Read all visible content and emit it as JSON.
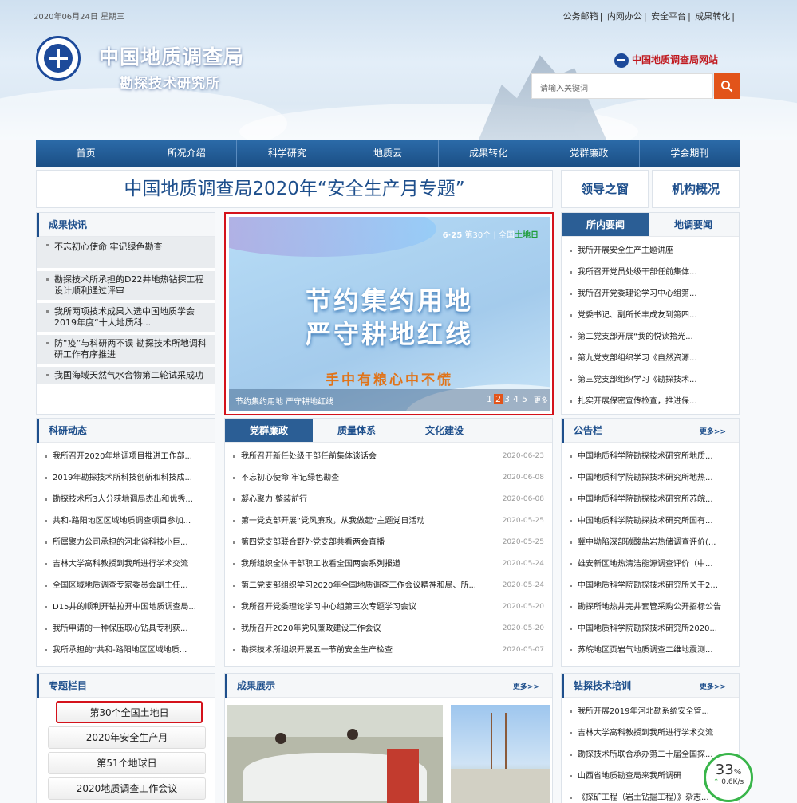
{
  "header": {
    "date": "2020年06月24日 星期三",
    "top_links": [
      "公务邮箱",
      "内网办公",
      "安全平台",
      "成果转化"
    ],
    "org_name": "中国地质调查局",
    "inst_name": "勘探技术研究所",
    "site_link": "中国地质调查局网站",
    "search_placeholder": "请输入关键词"
  },
  "nav": [
    "首页",
    "所况介绍",
    "科学研究",
    "地质云",
    "成果转化",
    "党群廉政",
    "学会期刊"
  ],
  "banner": {
    "title": "中国地质调查局2020年“安全生产月专题”",
    "btn1": "领导之窗",
    "btn2": "机构概况"
  },
  "kuaixun": {
    "title": "成果快讯",
    "items": [
      "不忘初心使命 牢记绿色勘查",
      "勘探技术所承担的D22井地热钻探工程设计顺利通过评审",
      "我所两项技术成果入选中国地质学会2019年度“十大地质科...",
      "防“疫”与科研两不误 勘探技术所地调科研工作有序推进",
      "我国海域天然气水合物第二轮试采成功"
    ]
  },
  "slider": {
    "tag_date": "6·25",
    "tag_rest": "第30个 | 全国",
    "tag_green": "土地日",
    "line1": "节约集约用地",
    "line2": "严守耕地红线",
    "line3": "手中有粮心中不慌",
    "caption": "节约集约用地 严守耕地红线",
    "pages": [
      "1",
      "2",
      "3",
      "4",
      "5"
    ],
    "more": "更多"
  },
  "suonei": {
    "tab1": "所内要闻",
    "tab2": "地调要闻",
    "items": [
      "我所开展安全生产主题讲座",
      "我所召开党员处级干部任前集体...",
      "我所召开党委理论学习中心组第...",
      "党委书记、副所长丰成友到第四...",
      "第二党支部开展“我的悦读拾光...",
      "第九党支部组织学习《自然资源...",
      "第三党支部组织学习《勘探技术...",
      "扎实开展保密宣传检查，推进保..."
    ]
  },
  "keyan": {
    "title": "科研动态",
    "items": [
      "我所召开2020年地调项目推进工作部...",
      "2019年勘探技术所科技创新和科技成...",
      "勘探技术所3人分获地调局杰出和优秀...",
      "共和-路阳地区区域地质调查项目参加...",
      "所属聚力公司承担的河北省科技小巨...",
      "吉林大学高科教授到我所进行学术交流",
      "全国区域地质调查专家委员会副主任...",
      "D15井的顺利开钻拉开中国地质调查局...",
      "我所申请的一种保压取心钻具专利获...",
      "我所承担的“共和-路阳地区区域地质..."
    ]
  },
  "dangqun": {
    "tabs": [
      "党群廉政",
      "质量体系",
      "文化建设"
    ],
    "items": [
      [
        "我所召开新任处级干部任前集体谈话会",
        "2020-06-23"
      ],
      [
        "不忘初心使命 牢记绿色勘查",
        "2020-06-08"
      ],
      [
        "凝心聚力 整装前行",
        "2020-06-08"
      ],
      [
        "第一党支部开展“党风廉政，从我做起”主题党日活动",
        "2020-05-25"
      ],
      [
        "第四党支部联合野外党支部共看两会直播",
        "2020-05-25"
      ],
      [
        "我所组织全体干部职工收看全国两会系列报道",
        "2020-05-24"
      ],
      [
        "第二党支部组织学习2020年全国地质调查工作会议精神和局、所...",
        "2020-05-24"
      ],
      [
        "我所召开党委理论学习中心组第三次专题学习会议",
        "2020-05-20"
      ],
      [
        "我所召开2020年党风廉政建设工作会议",
        "2020-05-20"
      ],
      [
        "勘探技术所组织开展五一节前安全生产检查",
        "2020-05-07"
      ]
    ]
  },
  "gonggao": {
    "title": "公告栏",
    "more": "更多>>",
    "items": [
      "中国地质科学院勘探技术研究所地质...",
      "中国地质科学院勘探技术研究所地热...",
      "中国地质科学院勘探技术研究所苏皖...",
      "中国地质科学院勘探技术研究所国有...",
      "冀中坳陷深部碳酸盐岩热储调查评价(...",
      "雄安新区地热清洁能源调查评价（中...",
      "中国地质科学院勘探技术研究所关于2...",
      "勘探所地热井完井套管采购公开招标公告",
      "中国地质科学院勘探技术研究所2020...",
      "苏皖地区页岩气地质调查二维地震测..."
    ]
  },
  "zhuanti": {
    "title": "专题栏目",
    "items": [
      "第30个全国土地日",
      "2020年安全生产月",
      "第51个地球日",
      "2020地质调查工作会议"
    ]
  },
  "chengguo": {
    "title": "成果展示",
    "more": "更多>>"
  },
  "zuantan": {
    "title": "钻探技术培训",
    "more": "更多>>",
    "items": [
      "我所开展2019年河北勘系统安全管...",
      "吉林大学高科教授到我所进行学术交流",
      "勘探技术所联合承办第二十届全国探...",
      "山西省地质勘查局来我所调研",
      "《探矿工程（岩土钻掘工程）》杂志..."
    ]
  },
  "speed": {
    "pct": "33",
    "unit": "%",
    "rate": "0.6K/s"
  }
}
